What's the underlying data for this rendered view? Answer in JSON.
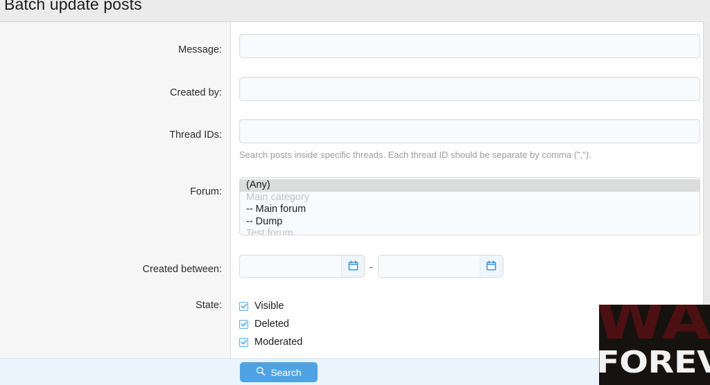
{
  "header": {
    "title": "Batch update posts"
  },
  "form": {
    "rows": [
      {
        "label": "Message:",
        "value": "",
        "placeholder": ""
      },
      {
        "label": "Created by:",
        "value": "",
        "placeholder": ""
      },
      {
        "label": "Thread IDs:",
        "value": "",
        "placeholder": ""
      },
      {
        "label": "Forum:"
      },
      {
        "label": "Created between:"
      },
      {
        "label": "State:"
      }
    ],
    "thread_ids_help": "Search posts inside specific threads. Each thread ID should be separate by comma (\",\").",
    "forum": {
      "options": [
        {
          "text": "(Any)",
          "selected": true,
          "disabled": false
        },
        {
          "text": "Main category",
          "selected": false,
          "disabled": true
        },
        {
          "text": "-- Main forum",
          "selected": false,
          "disabled": false
        },
        {
          "text": "-- Dump",
          "selected": false,
          "disabled": false
        },
        {
          "text": "Test forum",
          "selected": false,
          "disabled": true
        }
      ]
    },
    "created_between": {
      "from_value": "",
      "from_placeholder": "",
      "to_value": "",
      "to_placeholder": "",
      "separator": "-",
      "calendar_icon": "calendar-icon"
    },
    "state": {
      "items": [
        {
          "label": "Visible",
          "checked": true
        },
        {
          "label": "Deleted",
          "checked": true
        },
        {
          "label": "Moderated",
          "checked": true
        }
      ]
    }
  },
  "footer": {
    "search_label": "Search",
    "search_icon": "search-icon"
  },
  "watermark": {
    "line1": "WAR",
    "line2": "FOREVER"
  },
  "colors": {
    "accent": "#4fa3e3",
    "page_background": "#e9e9e9",
    "header_background": "#ebebeb",
    "gutter_background": "#f6f6f6",
    "footer_background": "#e9f4fc",
    "input_background": "#f7fbfd",
    "watermark_war": "#4c1013",
    "watermark_forever": "#f2f2f2"
  }
}
